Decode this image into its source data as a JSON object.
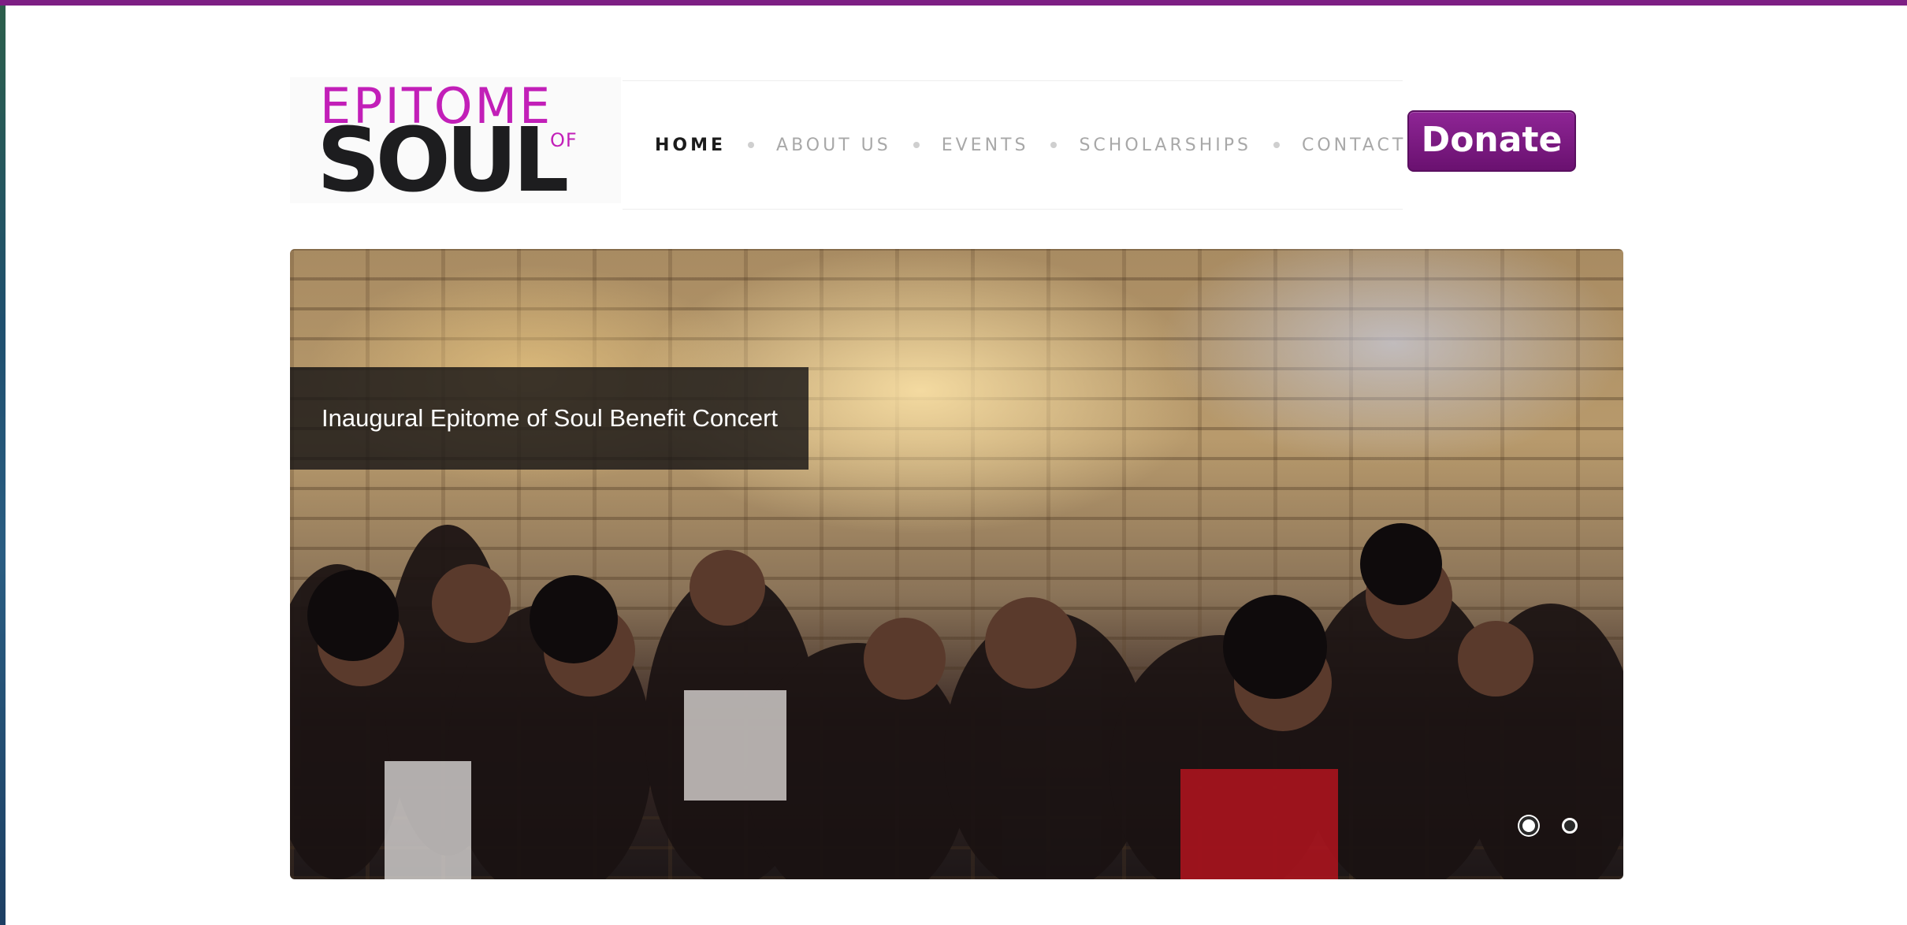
{
  "brand": {
    "logo_line1": "EPITOME",
    "logo_line2": "SOUL",
    "logo_small": "OF",
    "accent_color": "#7d1f84",
    "logo_pink": "#c21fb8"
  },
  "nav": {
    "items": [
      {
        "label": "HOME",
        "active": true
      },
      {
        "label": "ABOUT US",
        "active": false
      },
      {
        "label": "EVENTS",
        "active": false
      },
      {
        "label": "SCHOLARSHIPS",
        "active": false
      },
      {
        "label": "CONTACT",
        "active": false
      }
    ]
  },
  "donate": {
    "label": "Donate"
  },
  "slider": {
    "caption": "Inaugural Epitome of Soul Benefit Concert",
    "slide_count": 2,
    "active_slide": 1
  }
}
